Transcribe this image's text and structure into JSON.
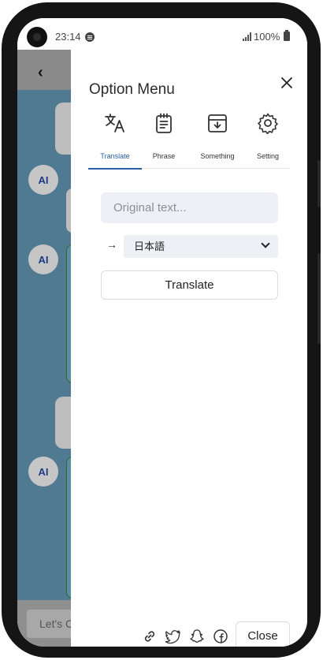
{
  "status_bar": {
    "time": "23:14",
    "battery": "100%"
  },
  "background_app": {
    "input_placeholder": "Let's C"
  },
  "drawer": {
    "title": "Option Menu",
    "tabs": [
      {
        "label": "Translate",
        "icon": "translate-icon",
        "active": true
      },
      {
        "label": "Phrase",
        "icon": "notepad-icon",
        "active": false
      },
      {
        "label": "Something",
        "icon": "archive-box-icon",
        "active": false
      },
      {
        "label": "Setting",
        "icon": "gear-icon",
        "active": false
      }
    ],
    "translate": {
      "original_placeholder": "Original text...",
      "arrow": "→",
      "target_language": "日本語",
      "button_label": "Translate"
    },
    "footer": {
      "icons": [
        "link-icon",
        "twitter-icon",
        "snapchat-icon",
        "facebook-icon"
      ],
      "close_label": "Close"
    }
  },
  "colors": {
    "accent": "#2a61a6",
    "app_background": "#4f7a92",
    "field_bg": "#edf1f5"
  }
}
